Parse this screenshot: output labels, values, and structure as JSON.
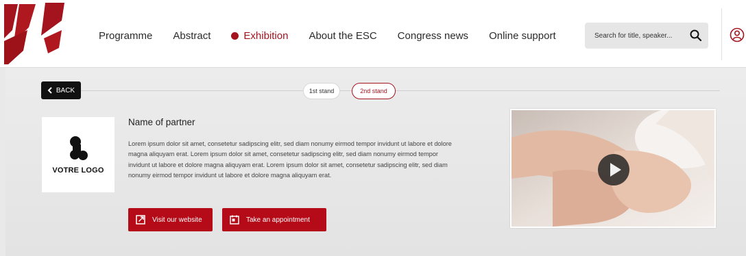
{
  "header": {
    "nav": [
      {
        "label": "Programme",
        "active": false
      },
      {
        "label": "Abstract",
        "active": false
      },
      {
        "label": "Exhibition",
        "active": true
      },
      {
        "label": "About the ESC",
        "active": false
      },
      {
        "label": "Congress news",
        "active": false
      },
      {
        "label": "Online support",
        "active": false
      }
    ],
    "search_placeholder": "Search for title, speaker...",
    "search_icon": "search-icon",
    "user_icon": "user-icon"
  },
  "back": {
    "label": "BACK",
    "icon": "chevron-left-icon"
  },
  "stands": [
    {
      "label": "1st stand",
      "active": false
    },
    {
      "label": "2nd stand",
      "active": true
    }
  ],
  "partner": {
    "logo_text": "VOTRE LOGO",
    "name": "Name of partner",
    "description": "Lorem ipsum dolor sit amet, consetetur sadipscing elitr, sed diam nonumy eirmod tempor invidunt ut labore et dolore magna aliquyam erat. Lorem ipsum dolor sit amet, consetetur sadipscing elitr, sed diam nonumy eirmod tempor invidunt ut labore et dolore magna aliquyam erat. Lorem ipsum dolor sit amet, consetetur sadipscing elitr, sed diam nonumy eirmod tempor invidunt ut labore et dolore magna aliquyam erat."
  },
  "actions": {
    "website_label": "Visit our website",
    "website_icon": "external-link-icon",
    "appointment_label": "Take an appointment",
    "appointment_icon": "calendar-icon"
  },
  "video": {
    "play_icon": "play-icon"
  },
  "colors": {
    "accent": "#b50a17",
    "nav_active": "#a3141f",
    "back_button": "#111111"
  }
}
